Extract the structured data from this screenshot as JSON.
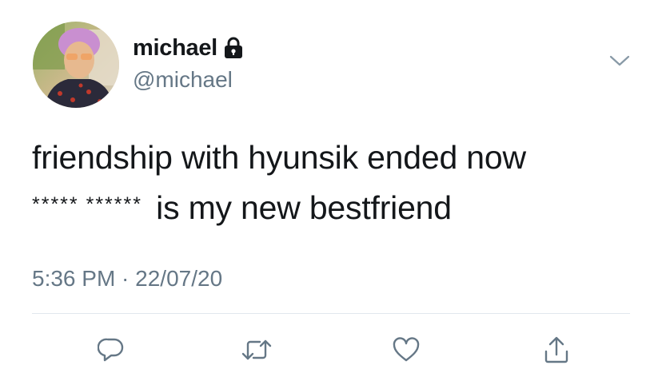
{
  "author": {
    "display_name": "michael",
    "handle": "@michael",
    "avatar_icon": "profile-photo",
    "protected_icon": "lock-icon"
  },
  "tweet": {
    "line1": "friendship with hyunsik ended now",
    "censored": "***** ******",
    "line2_rest": "is my new bestfriend",
    "timestamp": "5:36 PM · 22/07/20"
  },
  "actions": [
    {
      "name": "reply",
      "icon": "reply-icon"
    },
    {
      "name": "retweet",
      "icon": "retweet-icon"
    },
    {
      "name": "like",
      "icon": "heart-icon"
    },
    {
      "name": "share",
      "icon": "share-icon"
    }
  ],
  "colors": {
    "text": "#14171a",
    "secondary": "#657786",
    "divider": "#e1e8ed",
    "icon": "#657786"
  }
}
